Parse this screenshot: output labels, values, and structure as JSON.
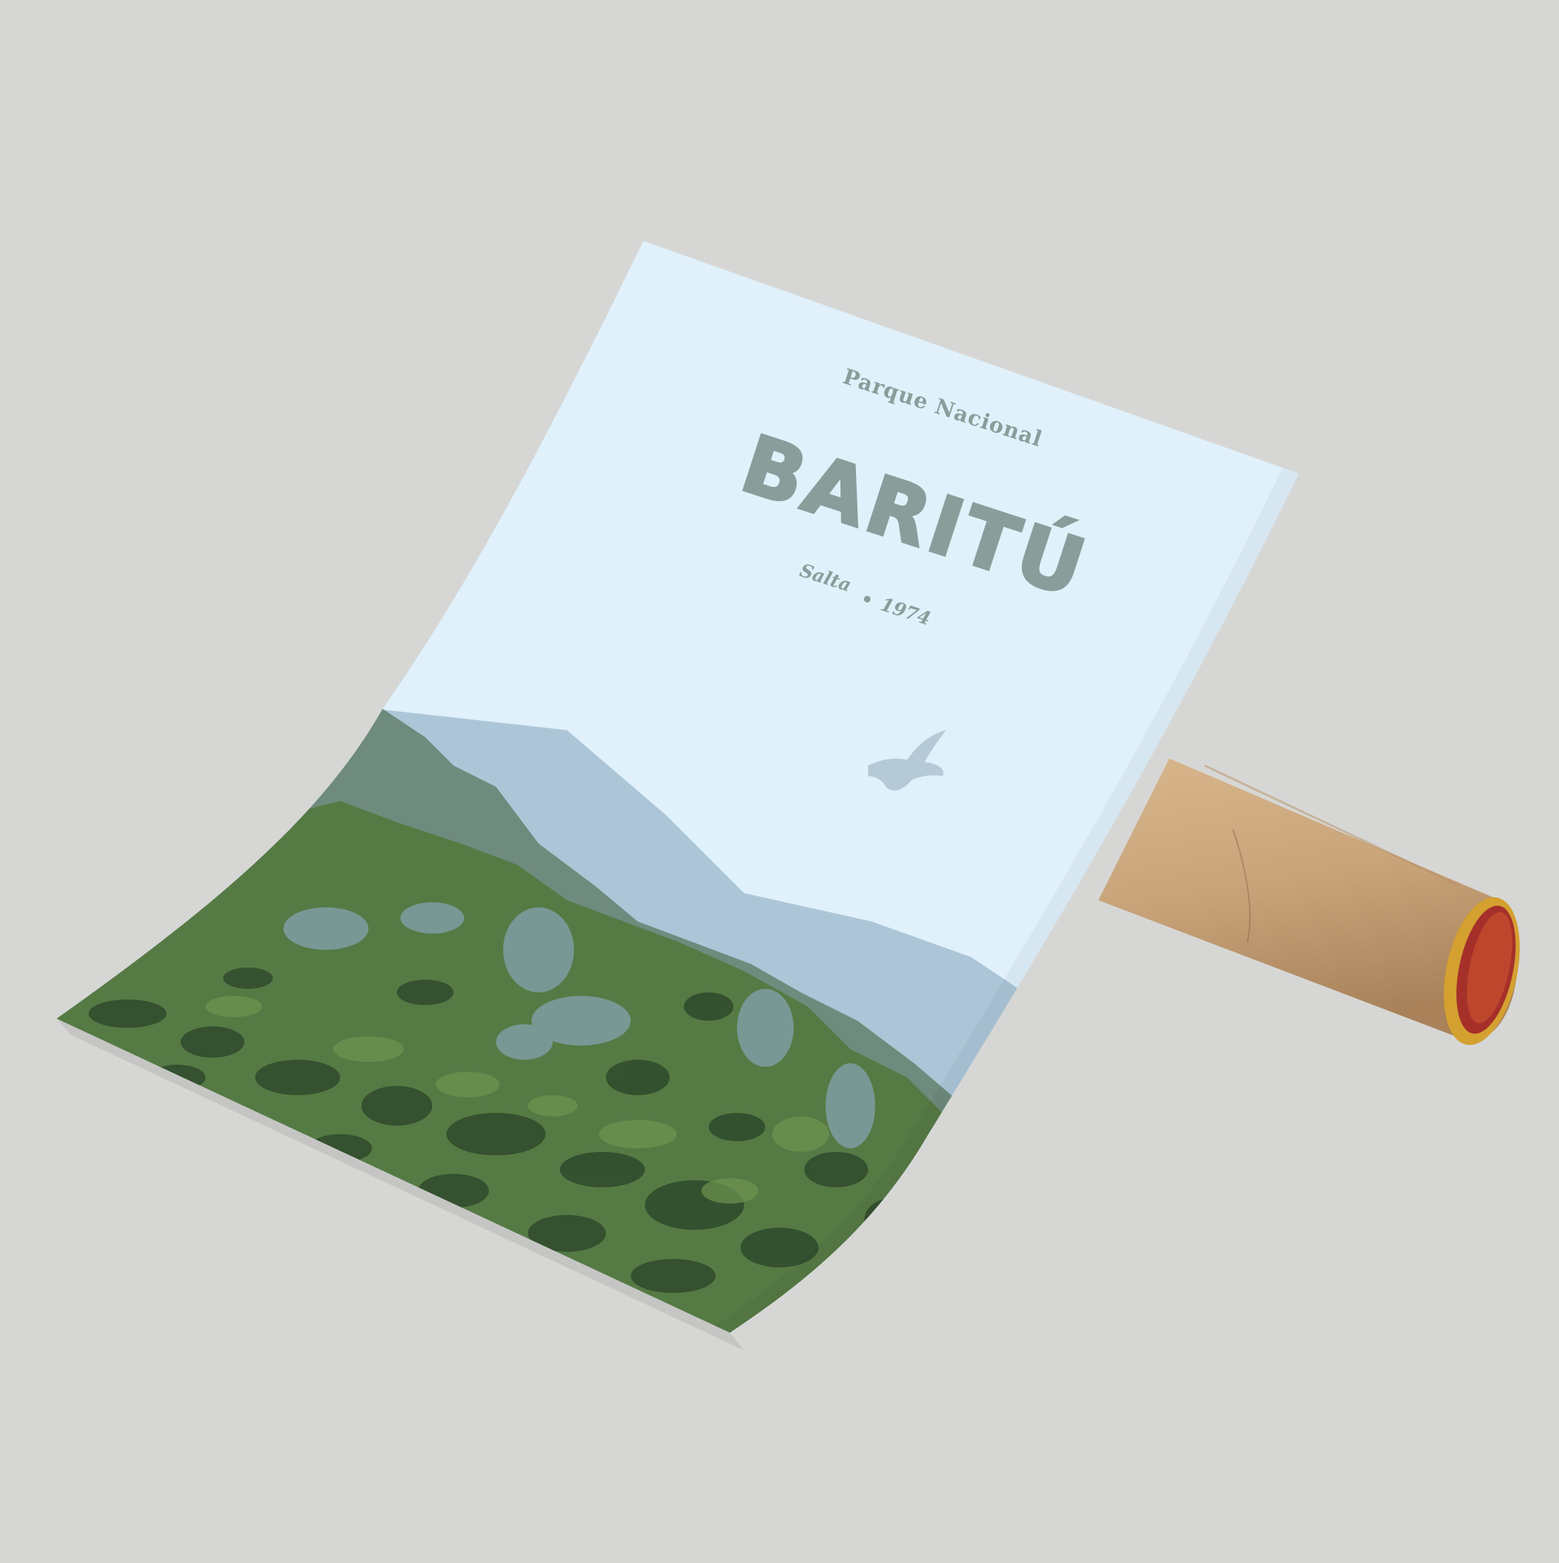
{
  "poster": {
    "subtitle": "Parque Nacional",
    "title": "BARITÚ",
    "location": "Salta",
    "separator": "•",
    "year": "1974"
  },
  "colors": {
    "background": "#d6d7d5",
    "sky": "#e0f1fb",
    "text": "#899d9a",
    "far_mountain": "#acc6d8",
    "mid_mountain": "#6f8b7d",
    "forest": "#567a44",
    "forest_dark": "#2f4a2c",
    "tube": "#c9a47a",
    "tube_rim": "#c48a25"
  },
  "icons": {
    "bird": "condor-silhouette"
  }
}
